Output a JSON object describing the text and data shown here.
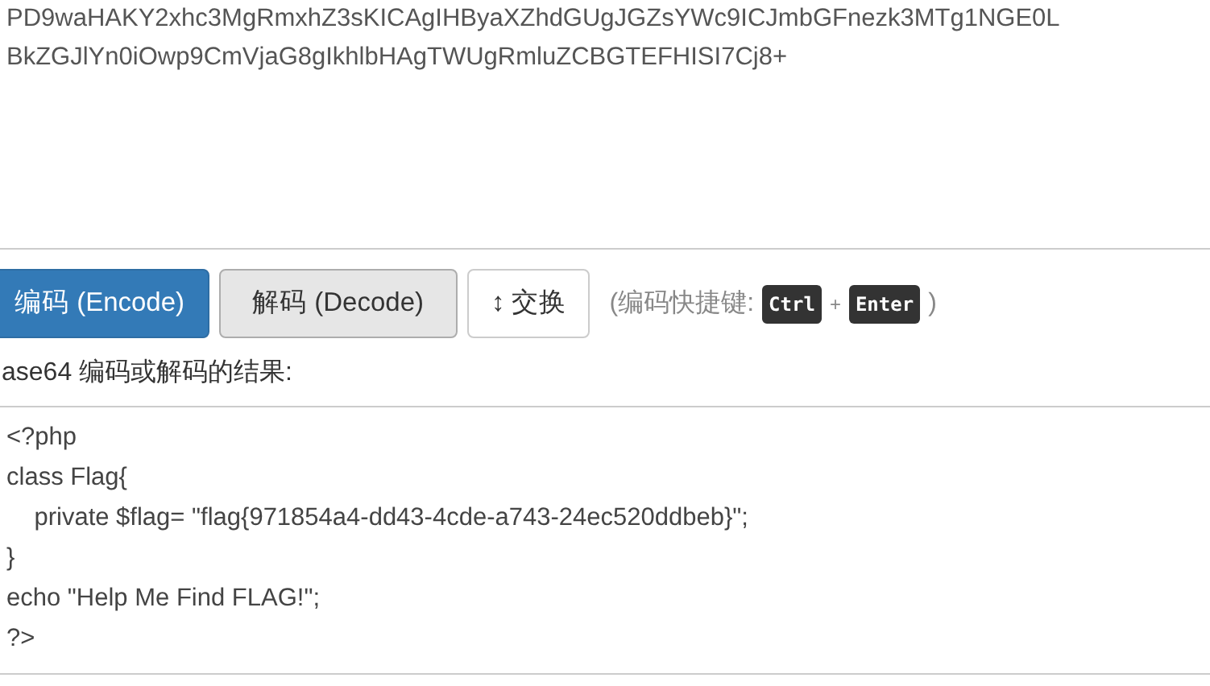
{
  "input": {
    "lines": [
      "PD9waHAKY2xhc3MgRmxhZ3sKICAgIHByaXZhdGUgJGZsYWc9ICJmbGFnezk3MTg1NGE0L",
      "BkZGJlYn0iOwp9CmVjaG8gIkhlbHAgTWUgRmluZCBGTEFHISI7Cj8+"
    ]
  },
  "buttons": [
    {
      "kind": "primary",
      "label": "编码 (Encode)"
    },
    {
      "kind": "secondary",
      "label": "解码 (Decode)"
    },
    {
      "kind": "swap",
      "icon": "↕",
      "label": "交换"
    }
  ],
  "shortcut": {
    "open": "(编码快捷键:",
    "keys": [
      "Ctrl",
      "Enter"
    ],
    "plus": "+",
    "close": ")"
  },
  "result_label": "ase64 编码或解码的结果:",
  "output": {
    "lines": [
      "<?php",
      "class Flag{",
      "    private $flag= \"flag{971854a4-dd43-4cde-a743-24ec520ddbeb}\";",
      "}",
      "echo \"Help Me Find FLAG!\";",
      "?>"
    ]
  }
}
